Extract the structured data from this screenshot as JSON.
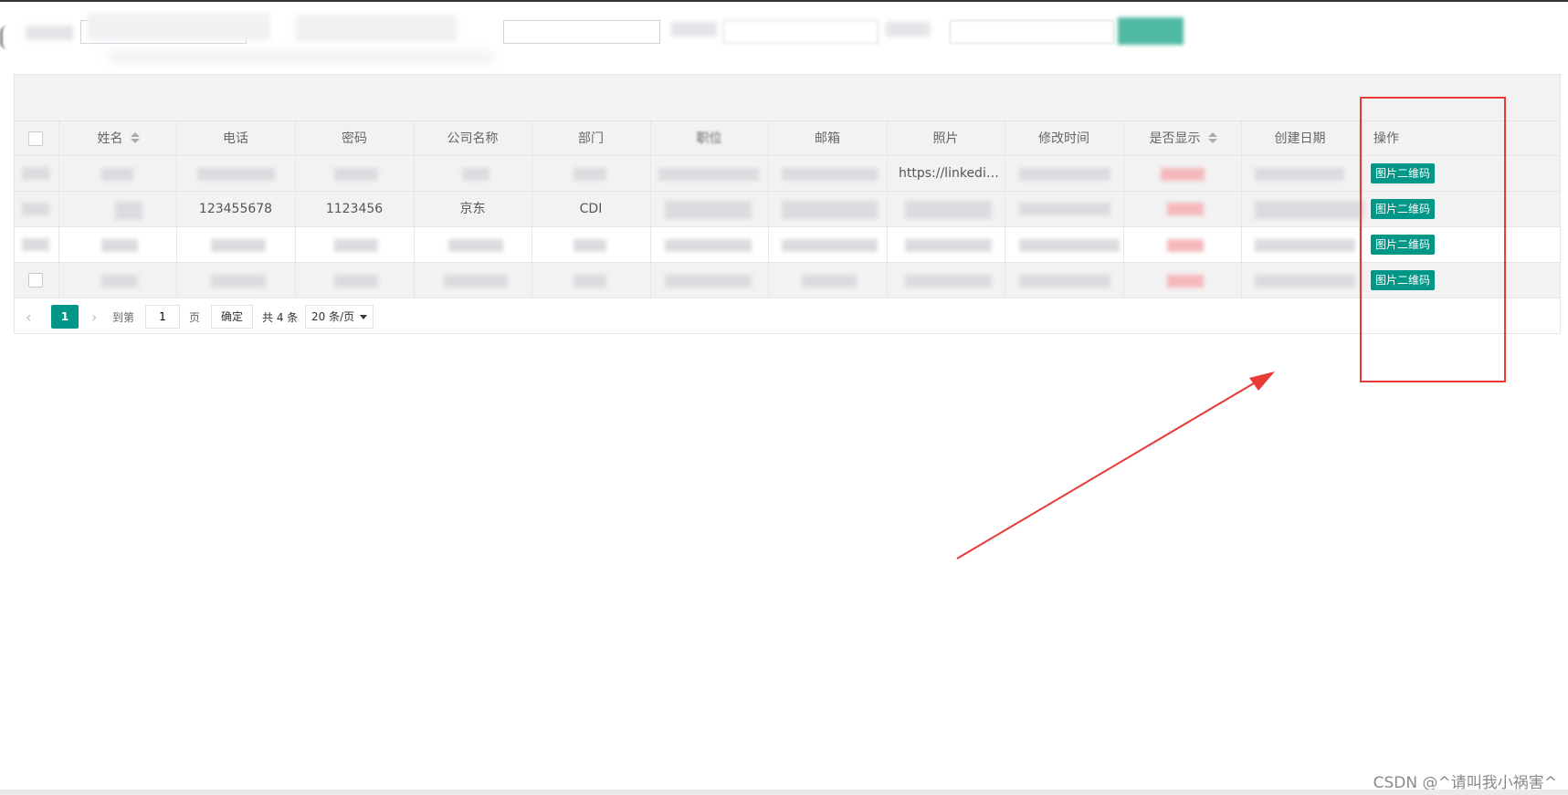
{
  "table": {
    "headers": [
      "姓名",
      "电话",
      "密码",
      "公司名称",
      "部门",
      "职位",
      "邮箱",
      "照片",
      "修改时间",
      "是否显示",
      "创建日期",
      "操作"
    ],
    "rows": [
      {
        "phone": "",
        "password": "",
        "company": "",
        "department": "",
        "photo": "https://linkedi…",
        "created": ""
      },
      {
        "phone": "123455678",
        "password": "1123456",
        "company": "京东",
        "department": "CDI",
        "photo": "",
        "created": ""
      },
      {
        "phone": "",
        "password": "",
        "company": "",
        "department": "",
        "photo": "",
        "created": ""
      },
      {
        "phone": "",
        "password": "",
        "company": "",
        "department": "",
        "photo": "",
        "created": ""
      }
    ],
    "action_label": "图片二维码"
  },
  "pagination": {
    "current_page": "1",
    "goto_label": "到第",
    "page_input_value": "1",
    "page_unit": "页",
    "confirm_label": "确定",
    "total_label": "共 4 条",
    "page_size_label": "20 条/页"
  },
  "annotation": {
    "watermark": "CSDN @^请叫我小祸害^",
    "highlight_color": "#e83a36"
  },
  "colors": {
    "accent": "#009688",
    "header_bg": "#f2f2f2",
    "border": "#e6e6e6"
  }
}
